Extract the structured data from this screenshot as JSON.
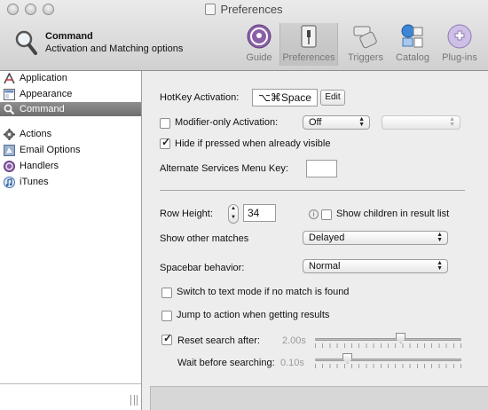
{
  "window": {
    "title": "Preferences"
  },
  "header": {
    "title": "Command",
    "subtitle": "Activation and Matching options"
  },
  "toolbar": {
    "items": [
      {
        "label": "Guide",
        "icon": "guide-icon"
      },
      {
        "label": "Preferences",
        "icon": "preferences-icon",
        "selected": true
      },
      {
        "label": "Triggers",
        "icon": "triggers-icon"
      },
      {
        "label": "Catalog",
        "icon": "catalog-icon"
      },
      {
        "label": "Plug-ins",
        "icon": "plugins-icon"
      }
    ]
  },
  "sidebar": {
    "items": [
      {
        "label": "Application",
        "icon": "application-icon"
      },
      {
        "label": "Appearance",
        "icon": "appearance-icon"
      },
      {
        "label": "Command",
        "icon": "magnifier-icon",
        "selected": true
      },
      {
        "label": "Actions",
        "icon": "gear-icon"
      },
      {
        "label": "Email Options",
        "icon": "email-icon"
      },
      {
        "label": "Handlers",
        "icon": "handlers-icon"
      },
      {
        "label": "iTunes",
        "icon": "itunes-icon"
      }
    ]
  },
  "settings": {
    "hotkey_label": "HotKey Activation:",
    "hotkey_value": "⌥⌘Space",
    "hotkey_edit": "Edit",
    "modifier_label": "Modifier-only Activation:",
    "modifier_value": "Off",
    "modifier_second_value": "",
    "hide_label": "Hide if pressed when already visible",
    "alt_services_label": "Alternate Services Menu Key:",
    "alt_services_value": "",
    "row_height_label": "Row Height:",
    "row_height_value": "34",
    "show_children_label": "Show children in result list",
    "other_matches_label": "Show other matches",
    "other_matches_value": "Delayed",
    "spacebar_label": "Spacebar behavior:",
    "spacebar_value": "Normal",
    "text_mode_label": "Switch to text mode if no match is found",
    "jump_action_label": "Jump to action when getting results",
    "reset_search_label": "Reset search after:",
    "reset_search_value": "2.00s",
    "reset_search_level": 0.59,
    "wait_label": "Wait before searching:",
    "wait_value": "0.10s",
    "wait_level": 0.2
  },
  "checkbox_states": {
    "modifier_only": false,
    "hide_if_pressed": true,
    "show_children": false,
    "text_mode": false,
    "jump_action": false,
    "reset_search": true
  }
}
